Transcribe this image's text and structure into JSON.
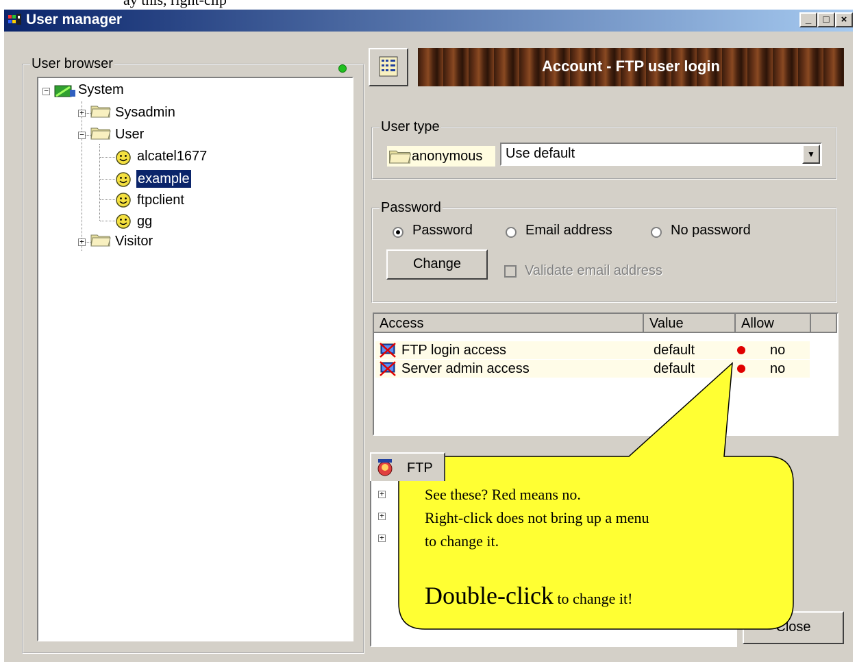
{
  "top_fragment": "ay this, right-clip",
  "window": {
    "title": "User manager"
  },
  "title_buttons": {
    "minimize": "_",
    "maximize": "□",
    "close": "×"
  },
  "user_browser": {
    "legend": "User browser",
    "tree": {
      "root": "System",
      "groups": [
        {
          "label": "Sysadmin",
          "expanded": false
        },
        {
          "label": "User",
          "expanded": true,
          "children": [
            "alcatel1677",
            "example",
            "ftpclient",
            "gg"
          ],
          "selected": "example"
        },
        {
          "label": "Visitor",
          "expanded": false
        }
      ]
    }
  },
  "header_banner": {
    "title": "Account - FTP user login"
  },
  "user_type": {
    "legend": "User type",
    "folder_label": "anonymous",
    "select_value": "Use default"
  },
  "password": {
    "legend": "Password",
    "options": [
      "Password",
      "Email address",
      "No password"
    ],
    "selected": "Password",
    "change_button": "Change",
    "validate_label": "Validate email address",
    "validate_checked": false
  },
  "access_table": {
    "columns": [
      "Access",
      "Value",
      "Allow"
    ],
    "rows": [
      {
        "access": "FTP login access",
        "value": "default",
        "allow": "no"
      },
      {
        "access": "Server admin access",
        "value": "default",
        "allow": "no"
      }
    ]
  },
  "tabs": {
    "first": "FTP"
  },
  "close_button": "Close",
  "callout": {
    "line1": "See these? Red means no.",
    "line2": "Right-click does not bring up a menu",
    "line3": "to change it.",
    "big_text": "Double-click",
    "end_text": " to change it!"
  },
  "colors": {
    "title_start": "#0a246a",
    "title_end": "#a6caf0",
    "callout_fill": "#ffff33",
    "selection": "#0a246a",
    "deny_dot": "#e00000"
  }
}
